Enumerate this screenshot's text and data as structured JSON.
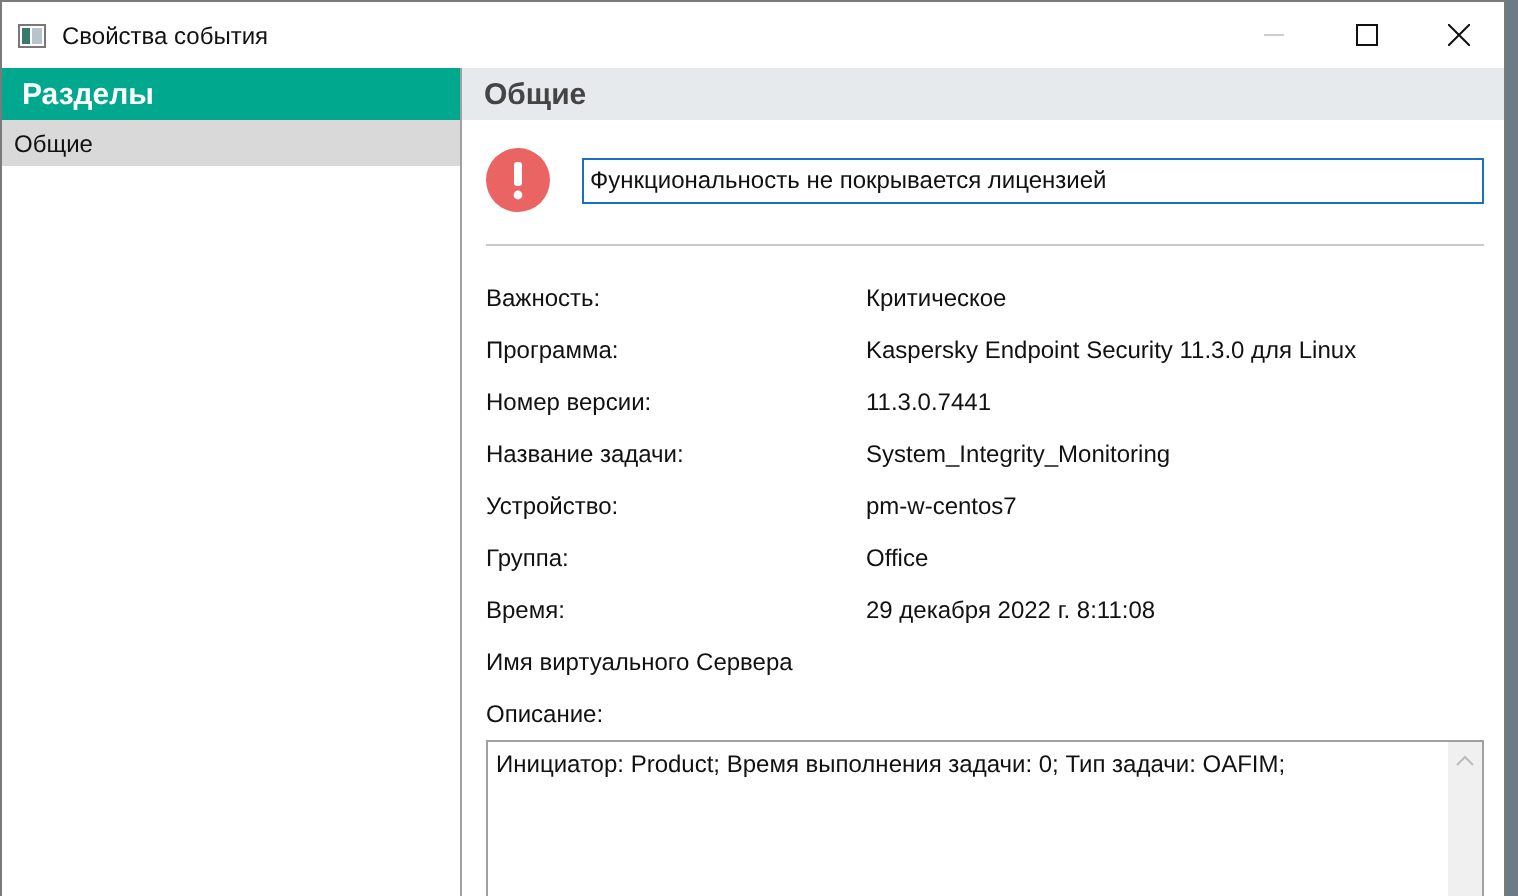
{
  "window": {
    "title": "Свойства события"
  },
  "sidebar": {
    "title": "Разделы",
    "items": [
      {
        "label": "Общие",
        "selected": true
      }
    ]
  },
  "section": {
    "title": "Общие",
    "message": "Функциональность не покрывается лицензией"
  },
  "properties": [
    {
      "label": "Важность:",
      "value": "Критическое"
    },
    {
      "label": "Программа:",
      "value": "Kaspersky Endpoint Security 11.3.0 для Linux"
    },
    {
      "label": "Номер версии:",
      "value": "11.3.0.7441"
    },
    {
      "label": "Название задачи:",
      "value": "System_Integrity_Monitoring"
    },
    {
      "label": "Устройство:",
      "value": "pm-w-centos7"
    },
    {
      "label": "Группа:",
      "value": "Office"
    },
    {
      "label": "Время:",
      "value": "29 декабря 2022 г. 8:11:08"
    },
    {
      "label": "Имя виртуального Сервера"
    }
  ],
  "description": {
    "label": "Описание:",
    "value": "Инициатор: Product; Время выполнения задачи: 0; Тип задачи: OAFIM;"
  }
}
